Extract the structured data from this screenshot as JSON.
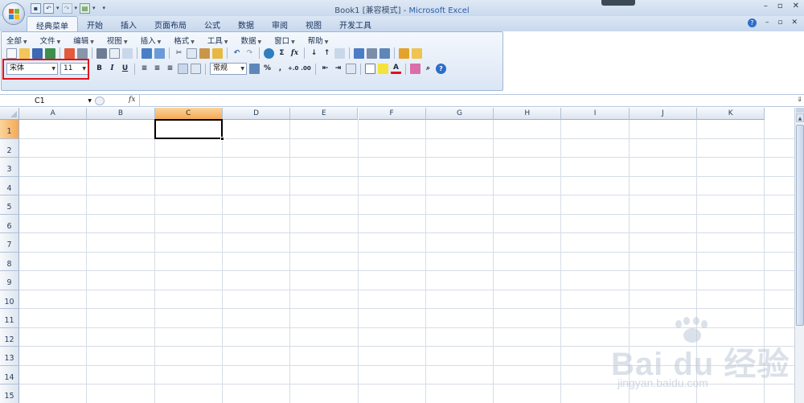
{
  "window": {
    "doc_name": "Book1",
    "mode": "[兼容模式]",
    "separator": "-",
    "app_name": "Microsoft Excel",
    "controls": [
      "–",
      "▫",
      "✕"
    ]
  },
  "qat": {
    "icons": [
      "save-icon",
      "undo-icon",
      "redo-icon",
      "print-preview-icon"
    ],
    "customize_caret": "▾"
  },
  "ribbon": {
    "tabs": [
      "经典菜单",
      "开始",
      "插入",
      "页面布局",
      "公式",
      "数据",
      "审阅",
      "视图",
      "开发工具"
    ],
    "active_tab": "经典菜单",
    "doc_controls": [
      "?",
      "–",
      "▫",
      "✕"
    ]
  },
  "classic_menu": {
    "items": [
      "全部",
      "文件",
      "编辑",
      "视图",
      "插入",
      "格式",
      "工具",
      "数据",
      "窗口",
      "帮助"
    ]
  },
  "toolbar": {
    "font_name": "宋体",
    "font_size": "11",
    "bold": "B",
    "italic": "I",
    "underline": "U",
    "number_format": "常规",
    "percent": "%",
    "comma": ",",
    "sigma": "Σ",
    "fx": "fx",
    "font_color_letter": "A",
    "highlight_color": "#e0121b"
  },
  "formula_bar": {
    "name_box": "C1",
    "fx_label": "fx",
    "formula": ""
  },
  "grid": {
    "columns": [
      "A",
      "B",
      "C",
      "D",
      "E",
      "F",
      "G",
      "H",
      "I",
      "J",
      "K"
    ],
    "rows": [
      "1",
      "2",
      "3",
      "4",
      "5",
      "6",
      "7",
      "8",
      "9",
      "10",
      "11",
      "12",
      "13",
      "14",
      "15"
    ],
    "selected_column": "C",
    "selected_row": "1",
    "selected_color": "#f5a957"
  },
  "watermark": {
    "brand": "Bai du 经验",
    "url": "jingyan.baidu.com"
  }
}
